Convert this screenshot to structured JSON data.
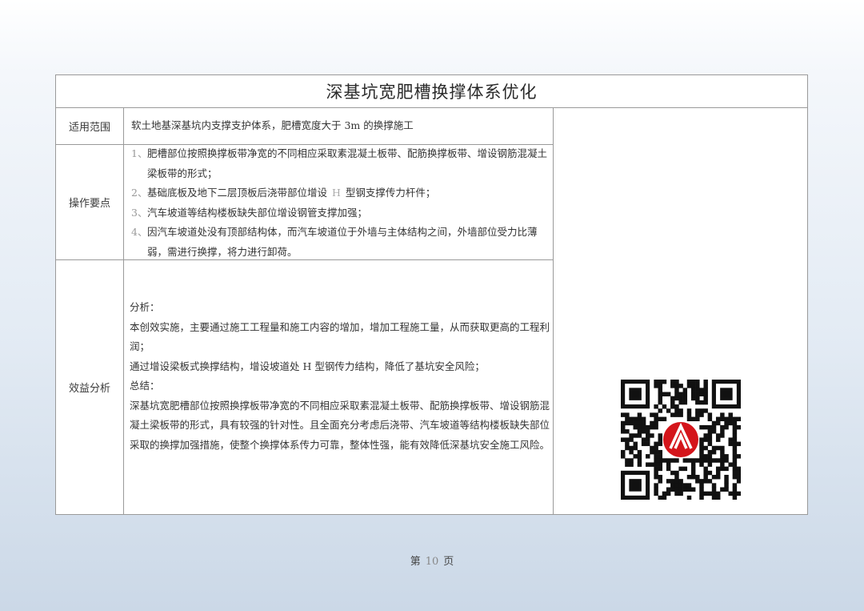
{
  "document": {
    "title": "深基坑宽肥槽换撑体系优化",
    "rows": {
      "scope": {
        "label": "适用范围",
        "text": "软土地基深基坑内支撑支护体系，肥槽宽度大于 3m 的换撑施工"
      },
      "key_points": {
        "label": "操作要点",
        "items": [
          {
            "num": "1、",
            "text": "肥槽部位按照换撑板带净宽的不同相应采取素混凝土板带、配筋换撑板带、增设钢筋混凝土梁板带的形式；"
          },
          {
            "num": "2、",
            "text_before": "基础底板及地下二层顶板后浇带部位增设",
            "text_mark": "H",
            "text_after": "型钢支撑传力杆件；"
          },
          {
            "num": "3、",
            "text": "汽车坡道等结构楼板缺失部位增设钢管支撑加强；"
          },
          {
            "num": "4、",
            "text": "因汽车坡道处没有顶部结构体，而汽车坡道位于外墙与主体结构之间，外墙部位受力比薄弱，需进行换撑，将力进行卸荷。"
          }
        ]
      },
      "benefit": {
        "label": "效益分析",
        "analysis_heading": "分析：",
        "analysis_p1": "本创效实施，主要通过施工工程量和施工内容的增加，增加工程施工量，从而获取更高的工程利润；",
        "analysis_p2": "通过增设梁板式换撑结构，增设坡道处 H 型钢传力结构，降低了基坑安全风险；",
        "summary_heading": "总结：",
        "summary_text": "深基坑宽肥槽部位按照换撑板带净宽的不同相应采取素混凝土板带、配筋换撑板带、增设钢筋混凝土梁板带的形式，具有较强的针对性。且全面充分考虑后浇带、汽车坡道等结构楼板缺失部位采取的换撑加强措施，使整个换撑体系传力可靠，整体性强，能有效降低深基坑安全施工风险。"
      }
    },
    "qr_icon": "qr-code-with-logo"
  },
  "footer": {
    "prefix": "第",
    "page": "10",
    "suffix": "页"
  },
  "colors": {
    "border": "#9a9a9a",
    "logo_red": "#d4151b",
    "background_top": "#ffffff",
    "background_bottom": "#cbd8e7"
  }
}
